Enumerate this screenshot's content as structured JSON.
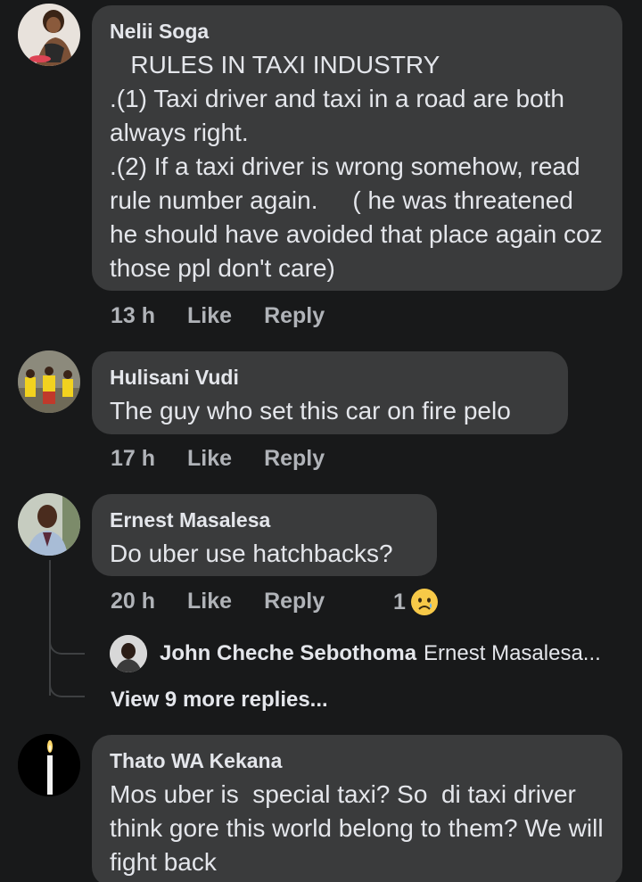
{
  "comments": [
    {
      "author": "Nelii Soga",
      "text": "   RULES IN TAXI INDUSTRY\n.(1) Taxi driver and taxi in a road are both always right.\n.(2) If a taxi driver is wrong somehow, read rule number again.     ( he was threatened he should have avoided that place again coz those ppl don't care)",
      "time": "13 h",
      "like": "Like",
      "reply": "Reply"
    },
    {
      "author": "Hulisani Vudi",
      "text": "The guy who set this car on fire pelo",
      "time": "17 h",
      "like": "Like",
      "reply": "Reply"
    },
    {
      "author": "Ernest Masalesa",
      "text": "Do uber use hatchbacks?",
      "time": "20 h",
      "like": "Like",
      "reply": "Reply",
      "reaction_count": "1",
      "reaction_icon": "sad-emoji-icon",
      "reply_preview": {
        "author": "John Cheche Sebothoma",
        "text": "Ernest Masalesa..."
      },
      "view_more": "View 9 more replies..."
    },
    {
      "author": "Thato WA Kekana",
      "text": "Mos uber is  special taxi? So  di taxi driver think gore this world belong to them? We will fight back"
    }
  ],
  "colors": {
    "background": "#18191a",
    "bubble": "#3a3b3c",
    "primary_text": "#e4e6eb",
    "secondary_text": "#b0b3b8"
  }
}
